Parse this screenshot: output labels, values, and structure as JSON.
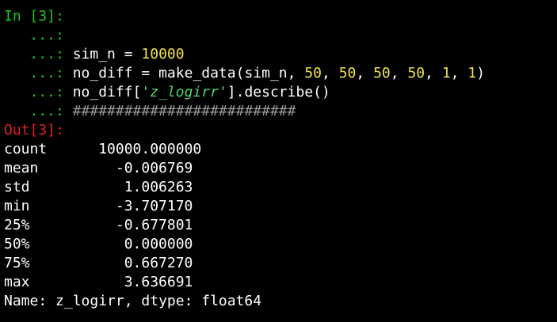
{
  "input": {
    "prompt": "In [3]:",
    "continuation": "   ...:",
    "lines": [
      {
        "parts": []
      },
      {
        "parts": [
          {
            "t": "sim_n = ",
            "k": "code"
          },
          {
            "t": "10000",
            "k": "num"
          }
        ]
      },
      {
        "parts": [
          {
            "t": "no_diff = make_data(sim_n, ",
            "k": "code"
          },
          {
            "t": "50",
            "k": "num"
          },
          {
            "t": ", ",
            "k": "code"
          },
          {
            "t": "50",
            "k": "num"
          },
          {
            "t": ", ",
            "k": "code"
          },
          {
            "t": "50",
            "k": "num"
          },
          {
            "t": ", ",
            "k": "code"
          },
          {
            "t": "50",
            "k": "num"
          },
          {
            "t": ", ",
            "k": "code"
          },
          {
            "t": "1",
            "k": "num"
          },
          {
            "t": ", ",
            "k": "code"
          },
          {
            "t": "1",
            "k": "num"
          },
          {
            "t": ")",
            "k": "code"
          }
        ]
      },
      {
        "parts": [
          {
            "t": "no_diff[",
            "k": "code"
          },
          {
            "t": "'z_logirr'",
            "k": "str"
          },
          {
            "t": "].describe()",
            "k": "code"
          }
        ]
      },
      {
        "parts": [
          {
            "t": "##########################",
            "k": "comment"
          }
        ]
      }
    ]
  },
  "output": {
    "prompt": "Out[3]:",
    "rows": [
      {
        "key": "count",
        "value": "10000.000000"
      },
      {
        "key": "mean",
        "value": "-0.006769"
      },
      {
        "key": "std",
        "value": "1.006263"
      },
      {
        "key": "min",
        "value": "-3.707170"
      },
      {
        "key": "25%",
        "value": "-0.677801"
      },
      {
        "key": "50%",
        "value": "0.000000"
      },
      {
        "key": "75%",
        "value": "0.667270"
      },
      {
        "key": "max",
        "value": "3.636691"
      }
    ],
    "footer": "Name: z_logirr, dtype: float64"
  },
  "colors": {
    "background": "#000000",
    "prompt_in": "#1ec51e",
    "prompt_out": "#e02020",
    "number": "#f0e24a",
    "string": "#4fd16e",
    "comment": "#9a9a9a",
    "text": "#ffffff"
  }
}
